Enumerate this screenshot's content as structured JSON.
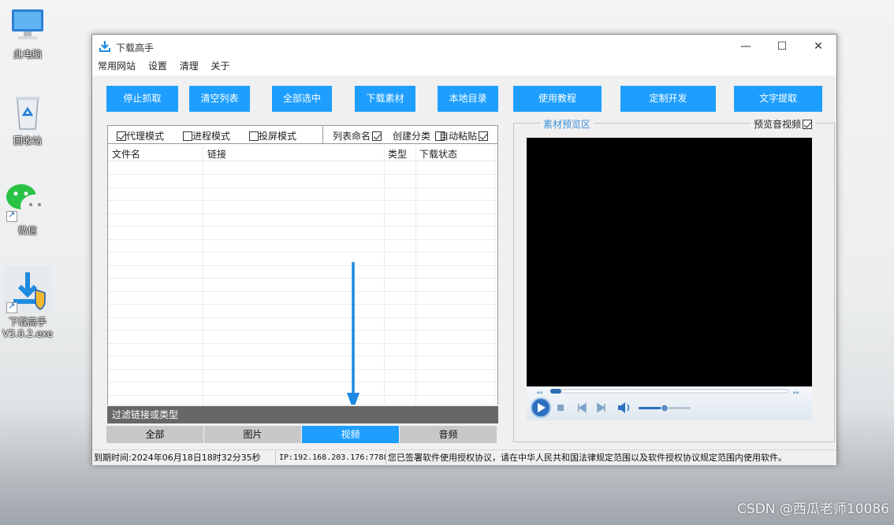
{
  "desktop": {
    "icons": [
      {
        "label": "此电脑",
        "icon": "computer-icon"
      },
      {
        "label": "回收站",
        "icon": "recycle-bin-icon"
      },
      {
        "label": "微信",
        "icon": "wechat-icon"
      },
      {
        "label_line1": "下载高手",
        "label_line2": "V3.0.2.exe",
        "icon": "downloader-app-icon"
      }
    ],
    "watermark": "CSDN @西瓜老师10086"
  },
  "window": {
    "title": "下载高手",
    "controls": {
      "minimize": "—",
      "maximize": "☐",
      "close": "✕"
    },
    "menu": [
      "常用网站",
      "设置",
      "清理",
      "关于"
    ],
    "toolbar": [
      "停止抓取",
      "清空列表",
      "全部选中",
      "下载素材",
      "本地目录",
      "使用教程",
      "定制开发",
      "文字提取"
    ],
    "options": [
      {
        "label": "代理模式",
        "checked": true
      },
      {
        "label": "进程模式",
        "checked": false
      },
      {
        "label": "投屏模式",
        "checked": false
      },
      {
        "label": "列表命名",
        "checked": true
      },
      {
        "label": "创建分类",
        "checked": false
      },
      {
        "label": "自动粘贴",
        "checked": true
      }
    ],
    "table": {
      "columns": [
        "文件名",
        "链接",
        "类型",
        "下载状态"
      ],
      "rows": []
    },
    "filter_label": "过滤链接或类型",
    "tabs": [
      {
        "label": "全部",
        "active": false
      },
      {
        "label": "图片",
        "active": false
      },
      {
        "label": "视频",
        "active": true
      },
      {
        "label": "音频",
        "active": false
      }
    ],
    "preview": {
      "group_title": "素材预览区",
      "preview_av_label": "预览音视频",
      "preview_av_checked": true
    },
    "status": {
      "expiry": "到期时间:2024年06月18日18时32分35秒",
      "ip": "IP:192.168.203.176:7788",
      "notice": "您已签署软件使用授权协议，请在中华人民共和国法律规定范围以及软件授权协议规定范围内使用软件。"
    },
    "colors": {
      "accent": "#1e9fff",
      "filter_bar": "#676767",
      "group_title": "#3b8fd9"
    }
  }
}
